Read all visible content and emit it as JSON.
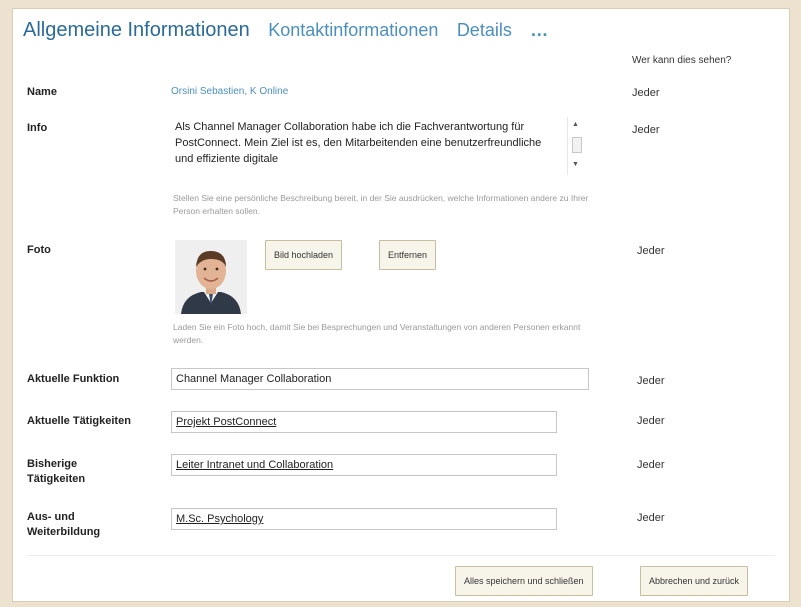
{
  "tabs": [
    {
      "label": "Allgemeine Informationen"
    },
    {
      "label": "Kontaktinformationen"
    },
    {
      "label": "Details"
    },
    {
      "label": "…"
    }
  ],
  "visibility_header": "Wer kann dies sehen?",
  "fields": {
    "name": {
      "label": "Name",
      "value": "Orsini Sebastien, K Online",
      "visibility": "Jeder"
    },
    "info": {
      "label": "Info",
      "value": "Als Channel Manager Collaboration habe ich die Fachverantwortung für PostConnect. Mein Ziel ist es, den Mitarbeitenden eine benutzerfreundliche und effiziente digitale",
      "hint": "Stellen Sie eine persönliche Beschreibung bereit, in der Sie ausdrücken, welche Informationen andere zu Ihrer Person erhalten sollen.",
      "visibility": "Jeder"
    },
    "foto": {
      "label": "Foto",
      "upload_label": "Bild hochladen",
      "remove_label": "Entfernen",
      "hint": "Laden Sie ein Foto hoch, damit Sie bei Besprechungen und Veranstaltungen von anderen Personen erkannt werden.",
      "visibility": "Jeder"
    },
    "aktuelle_funktion": {
      "label": "Aktuelle Funktion",
      "value": "Channel Manager Collaboration",
      "visibility": "Jeder"
    },
    "aktuelle_taetigkeiten": {
      "label": "Aktuelle Tätigkeiten",
      "value": "Projekt PostConnect",
      "visibility": "Jeder"
    },
    "bisherige_taetigkeiten": {
      "label_line1": "Bisherige",
      "label_line2": "Tätigkeiten",
      "value": "Leiter Intranet und Collaboration",
      "visibility": "Jeder"
    },
    "ausbildung": {
      "label_line1": "Aus- und",
      "label_line2": "Weiterbildung",
      "value": "M.Sc. Psychology",
      "visibility": "Jeder"
    }
  },
  "footer": {
    "save_label": "Alles speichern und schließen",
    "cancel_label": "Abbrechen und zurück"
  },
  "scroll_icons": {
    "up": "scroll-up-icon",
    "down": "scroll-down-icon"
  }
}
